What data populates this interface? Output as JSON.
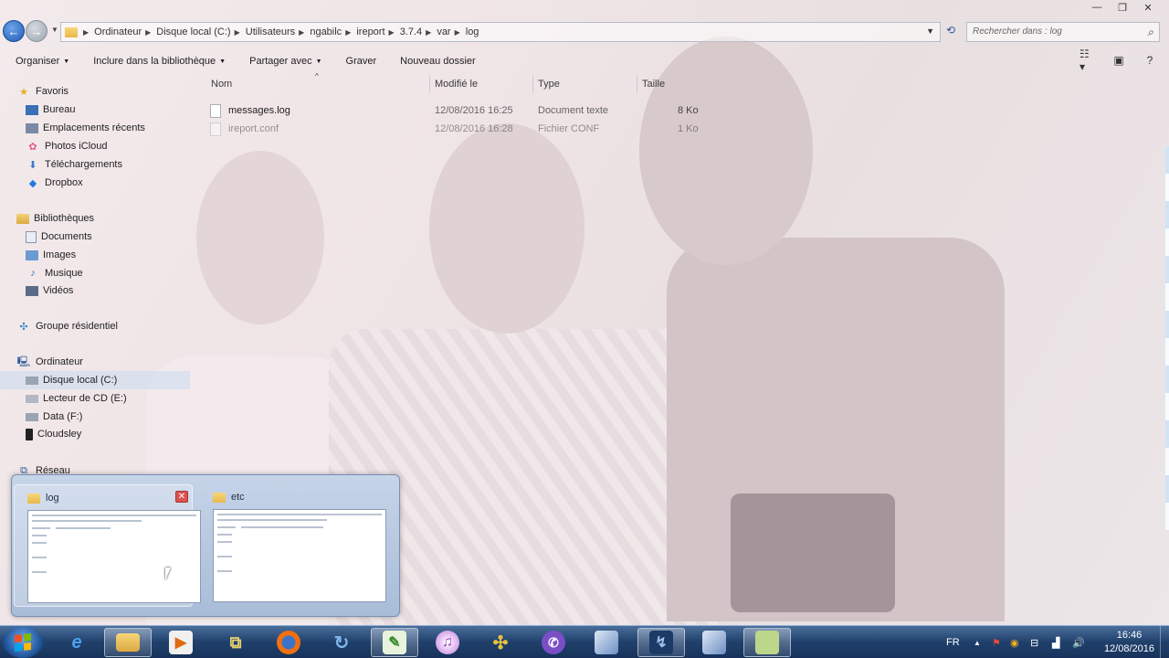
{
  "window": {
    "controls": [
      "—",
      "❐",
      "✕"
    ]
  },
  "address": {
    "crumbs": [
      "Ordinateur",
      "Disque local (C:)",
      "Utilisateurs",
      "ngabilc",
      "ireport",
      "3.7.4",
      "var",
      "log"
    ],
    "search_placeholder": "Rechercher dans : log"
  },
  "toolbar": {
    "organize": "Organiser",
    "include": "Inclure dans la bibliothèque",
    "share": "Partager avec",
    "burn": "Graver",
    "new_folder": "Nouveau dossier"
  },
  "nav": {
    "favorites": "Favoris",
    "fav_items": [
      "Bureau",
      "Emplacements récents",
      "Photos iCloud",
      "Téléchargements",
      "Dropbox"
    ],
    "libraries": "Bibliothèques",
    "lib_items": [
      "Documents",
      "Images",
      "Musique",
      "Vidéos"
    ],
    "homegroup": "Groupe résidentiel",
    "computer": "Ordinateur",
    "comp_items": [
      "Disque local (C:)",
      "Lecteur de CD (E:)",
      "Data (F:)",
      "Cloudsley"
    ],
    "network": "Réseau"
  },
  "columns": {
    "name": "Nom",
    "modified": "Modifié le",
    "type": "Type",
    "size": "Taille"
  },
  "files": [
    {
      "name": "messages.log",
      "modified": "12/08/2016 16:25",
      "type": "Document texte",
      "size": "8 Ko"
    },
    {
      "name": "ireport.conf",
      "modified": "12/08/2016 16:28",
      "type": "Fichier CONF",
      "size": "1 Ko"
    }
  ],
  "thumbnails": [
    {
      "title": "log",
      "close": "✕"
    },
    {
      "title": "etc"
    }
  ],
  "taskbar": {
    "lang": "FR",
    "time": "16:46",
    "date": "12/08/2016"
  }
}
